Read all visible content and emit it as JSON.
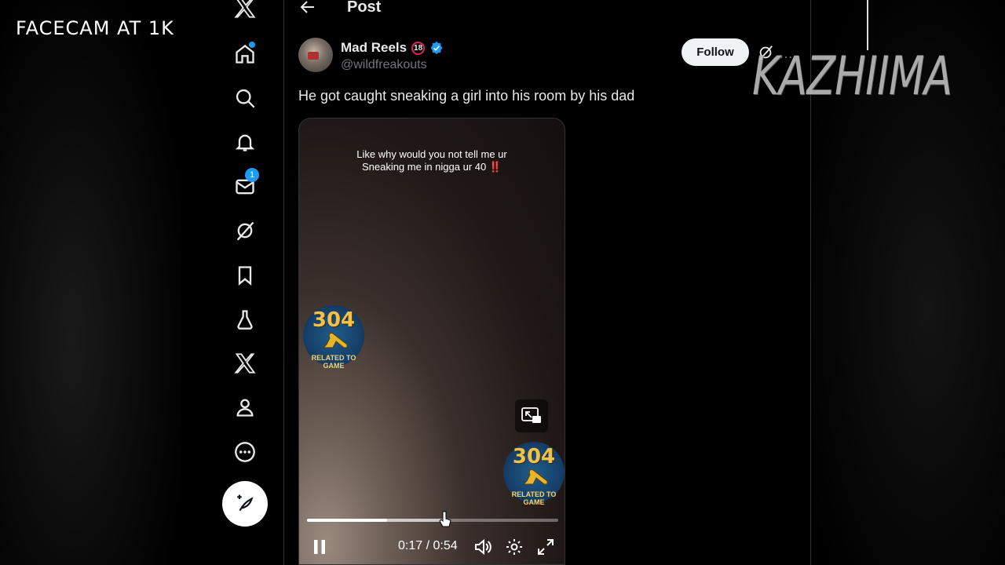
{
  "overlay": {
    "facecam_text": "FACECAM AT 1K",
    "watermark_text": "KAZHIIMA"
  },
  "nav": {
    "items": [
      {
        "name": "x-logo"
      },
      {
        "name": "home",
        "has_dot": true
      },
      {
        "name": "explore"
      },
      {
        "name": "notifications"
      },
      {
        "name": "messages",
        "badge": "1"
      },
      {
        "name": "grok"
      },
      {
        "name": "bookmarks"
      },
      {
        "name": "lab"
      },
      {
        "name": "premium"
      },
      {
        "name": "profile"
      },
      {
        "name": "more"
      }
    ],
    "compose_icon": "feather-plus-icon"
  },
  "header": {
    "title": "Post",
    "back_icon": "arrow-left-icon"
  },
  "post": {
    "author_name": "Mad Reels",
    "age_badge": "18",
    "verified": true,
    "handle": "@wildfreakouts",
    "follow_label": "Follow",
    "text": "He got caught sneaking a girl into his room by his dad",
    "more_dots": "…"
  },
  "video": {
    "caption_line1": "Like why would you not tell me ur",
    "caption_line2": "Sneaking me in nigga ur 40 ‼️",
    "logo_number": "304",
    "logo_text": "RELATED TO GAME",
    "time_current": "0:17",
    "time_total": "0:54",
    "time_display": "0:17 / 0:54",
    "progress": 0.32,
    "buffered": 0.55
  },
  "colors": {
    "accent": "#1d9bf0",
    "background": "#000000",
    "text": "#e7e9ea",
    "muted": "#71767b"
  }
}
